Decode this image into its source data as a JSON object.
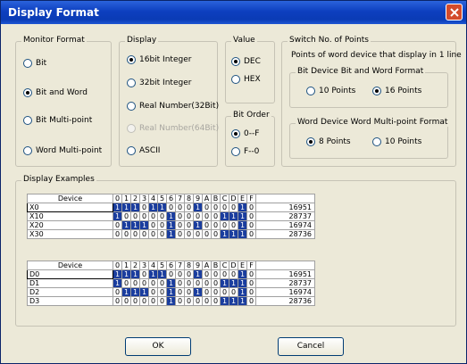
{
  "window": {
    "title": "Display Format"
  },
  "monitor_format": {
    "legend": "Monitor Format",
    "options": [
      "Bit",
      "Bit and Word",
      "Bit Multi-point",
      "Word Multi-point"
    ],
    "selected": "Bit and Word"
  },
  "display": {
    "legend": "Display",
    "options": [
      "16bit Integer",
      "32bit Integer",
      "Real Number(32Bit)",
      "Real Number(64Bit)",
      "ASCII"
    ],
    "selected": "16bit Integer",
    "disabled": [
      "Real Number(64Bit)"
    ]
  },
  "value": {
    "legend": "Value",
    "options": [
      "DEC",
      "HEX"
    ],
    "selected": "DEC"
  },
  "bit_order": {
    "legend": "Bit Order",
    "options": [
      "0--F",
      "F--0"
    ],
    "selected": "0--F"
  },
  "switch_points": {
    "legend": "Switch No. of Points",
    "description": "Points of word device that display in 1 line",
    "bit_device": {
      "legend": "Bit Device  Bit and Word Format",
      "options": [
        "10 Points",
        "16 Points"
      ],
      "selected": "16 Points"
    },
    "word_device": {
      "legend": "Word Device  Word Multi-point Format",
      "options": [
        "8 Points",
        "10 Points"
      ],
      "selected": "8 Points"
    }
  },
  "examples": {
    "legend": "Display Examples",
    "header": {
      "device": "Device",
      "bits": [
        "0",
        "1",
        "2",
        "3",
        "4",
        "5",
        "6",
        "7",
        "8",
        "9",
        "A",
        "B",
        "C",
        "D",
        "E",
        "F"
      ],
      "value": ""
    },
    "table1": [
      {
        "device": "X0",
        "bits": [
          1,
          1,
          1,
          0,
          1,
          1,
          0,
          0,
          0,
          1,
          0,
          0,
          0,
          0,
          1,
          0
        ],
        "value": "16951"
      },
      {
        "device": "X10",
        "bits": [
          1,
          0,
          0,
          0,
          0,
          0,
          1,
          0,
          0,
          0,
          0,
          0,
          1,
          1,
          1,
          0
        ],
        "value": "28737"
      },
      {
        "device": "X20",
        "bits": [
          0,
          1,
          1,
          1,
          0,
          0,
          1,
          0,
          0,
          1,
          0,
          0,
          0,
          0,
          1,
          0
        ],
        "value": "16974"
      },
      {
        "device": "X30",
        "bits": [
          0,
          0,
          0,
          0,
          0,
          0,
          1,
          0,
          0,
          0,
          0,
          0,
          1,
          1,
          1,
          0
        ],
        "value": "28736"
      }
    ],
    "table2": [
      {
        "device": "D0",
        "bits": [
          1,
          1,
          1,
          0,
          1,
          1,
          0,
          0,
          0,
          1,
          0,
          0,
          0,
          0,
          1,
          0
        ],
        "value": "16951"
      },
      {
        "device": "D1",
        "bits": [
          1,
          0,
          0,
          0,
          0,
          0,
          1,
          0,
          0,
          0,
          0,
          0,
          1,
          1,
          1,
          0
        ],
        "value": "28737"
      },
      {
        "device": "D2",
        "bits": [
          0,
          1,
          1,
          1,
          0,
          0,
          1,
          0,
          0,
          1,
          0,
          0,
          0,
          0,
          1,
          0
        ],
        "value": "16974"
      },
      {
        "device": "D3",
        "bits": [
          0,
          0,
          0,
          0,
          0,
          0,
          1,
          0,
          0,
          0,
          0,
          0,
          1,
          1,
          1,
          0
        ],
        "value": "28736"
      }
    ]
  },
  "buttons": {
    "ok": "OK",
    "cancel": "Cancel"
  },
  "icons": {
    "close": "close-icon"
  }
}
